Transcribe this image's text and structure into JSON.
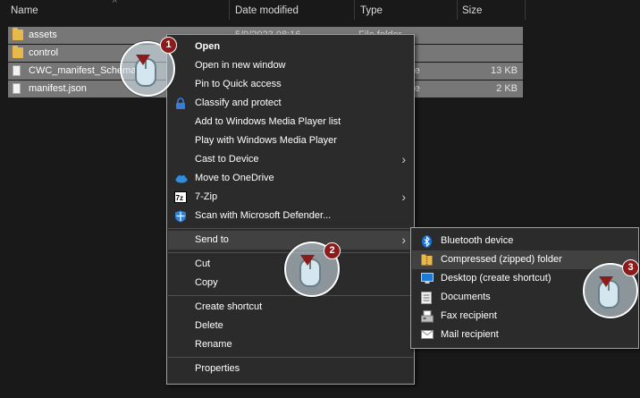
{
  "header": {
    "name": "Name",
    "date_modified": "Date modified",
    "type": "Type",
    "size": "Size"
  },
  "files": [
    {
      "name": "assets",
      "date": "5/9/2023 08:16",
      "type": "File folder",
      "size": "",
      "icon": "folder-icon"
    },
    {
      "name": "control",
      "date": "",
      "type": "",
      "size": "",
      "icon": "folder-icon"
    },
    {
      "name": "CWC_manifest_Schema",
      "date": "",
      "type": "File",
      "size": "13 KB",
      "icon": "file-icon"
    },
    {
      "name": "manifest.json",
      "date": "",
      "type": "File",
      "size": "2 KB",
      "icon": "file-icon"
    }
  ],
  "context_menu": {
    "items": [
      {
        "label": "Open"
      },
      {
        "label": "Open in new window"
      },
      {
        "label": "Pin to Quick access"
      },
      {
        "label": "Classify and protect",
        "icon": "lock-icon"
      },
      {
        "label": "Add to Windows Media Player list"
      },
      {
        "label": "Play with Windows Media Player"
      },
      {
        "label": "Cast to Device"
      },
      {
        "label": "Move to OneDrive",
        "icon": "onedrive-icon"
      },
      {
        "label": "7-Zip",
        "icon": "7zip-icon"
      },
      {
        "label": "Scan with Microsoft Defender...",
        "icon": "defender-icon"
      },
      {
        "label": "Send to"
      },
      {
        "label": "Cut"
      },
      {
        "label": "Copy"
      },
      {
        "label": "Create shortcut"
      },
      {
        "label": "Delete"
      },
      {
        "label": "Rename"
      },
      {
        "label": "Properties"
      }
    ]
  },
  "send_to_menu": {
    "items": [
      {
        "label": "Bluetooth device",
        "icon": "bluetooth-icon"
      },
      {
        "label": "Compressed (zipped) folder",
        "icon": "zip-folder-icon"
      },
      {
        "label": "Desktop (create shortcut)",
        "icon": "desktop-icon"
      },
      {
        "label": "Documents",
        "icon": "documents-icon"
      },
      {
        "label": "Fax recipient",
        "icon": "fax-icon"
      },
      {
        "label": "Mail recipient",
        "icon": "mail-icon"
      }
    ]
  },
  "callouts": [
    "1",
    "2",
    "3"
  ],
  "colors": {
    "background": "#191919",
    "selection": "#777777",
    "menu_bg": "#2b2b2b",
    "menu_hover": "#414141",
    "badge": "#8b1c1c"
  }
}
